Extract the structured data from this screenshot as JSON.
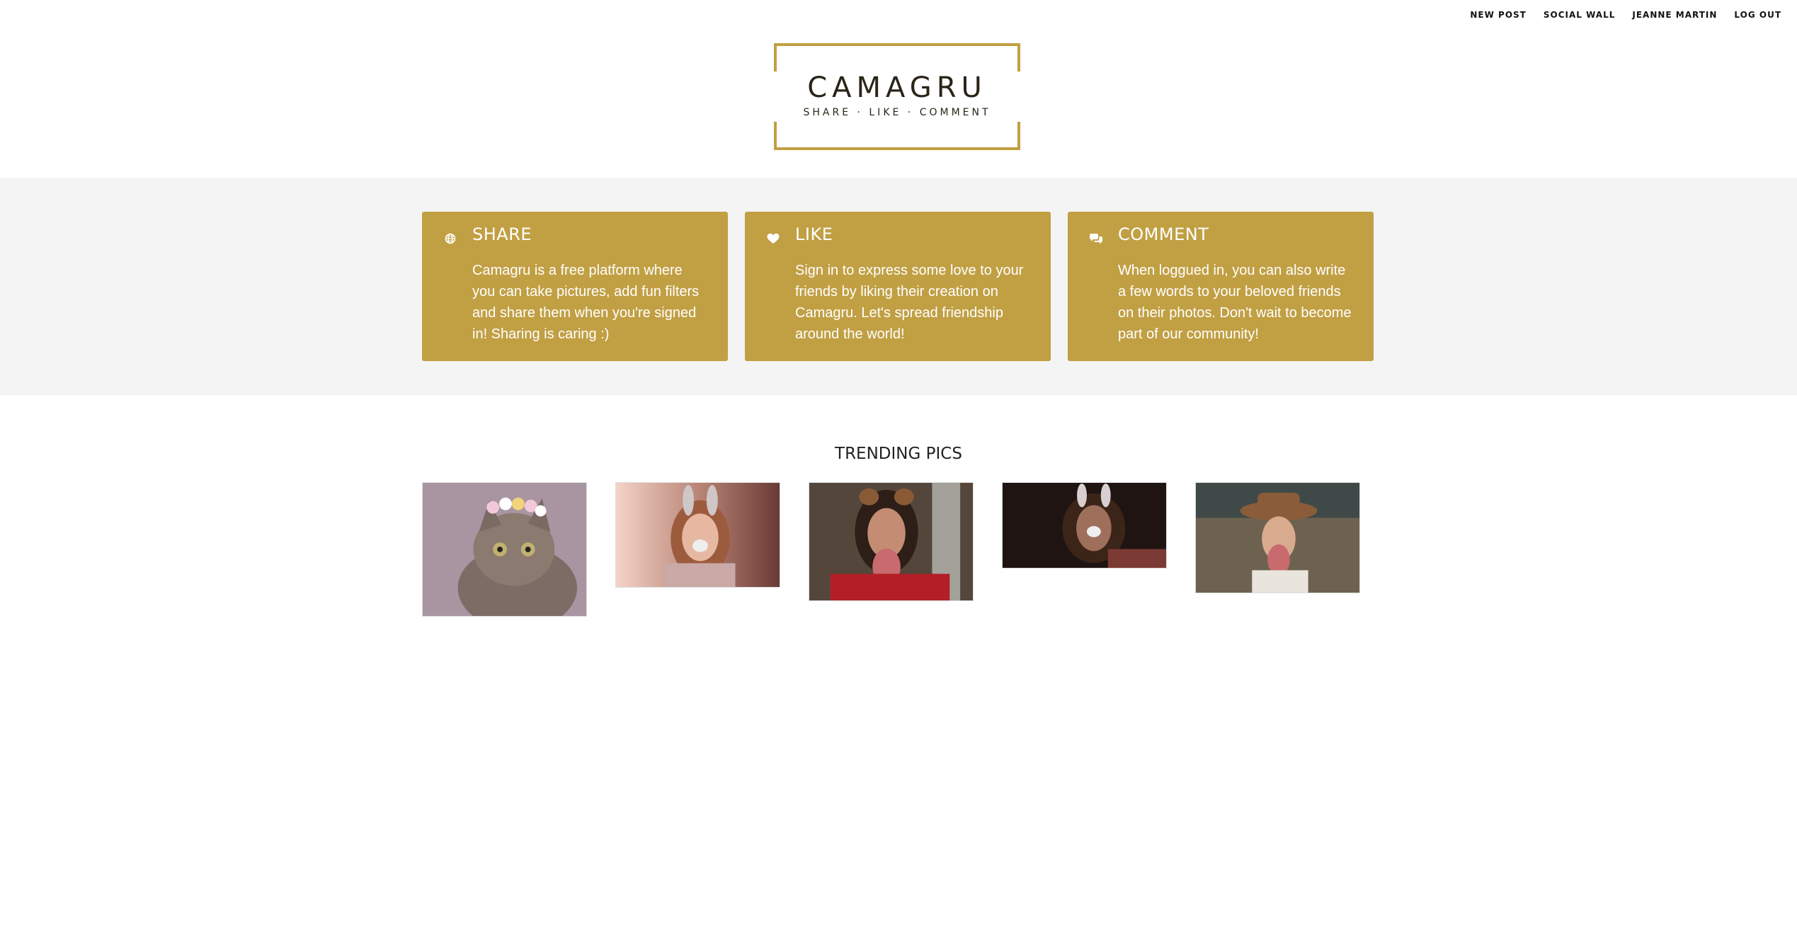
{
  "nav": {
    "new_post": "NEW POST",
    "social_wall": "SOCIAL WALL",
    "user": "JEANNE MARTIN",
    "logout": "LOG OUT"
  },
  "logo": {
    "title": "CAMAGRU",
    "subtitle": "SHARE · LIKE · COMMENT"
  },
  "features": [
    {
      "icon": "globe-icon",
      "title": "SHARE",
      "text": "Camagru is a free platform where you can take pictures, add fun filters and share them when you're signed in! Sharing is caring :)"
    },
    {
      "icon": "heart-icon",
      "title": "LIKE",
      "text": "Sign in to express some love to your friends by liking their creation on Camagru. Let's spread friendship around the world!"
    },
    {
      "icon": "comments-icon",
      "title": "COMMENT",
      "text": "When loggued in, you can also write a few words to your beloved friends on their photos. Don't wait to become part of our community!"
    }
  ],
  "trending": {
    "title": "TRENDING PICS"
  },
  "colors": {
    "accent": "#c19f43",
    "band": "#f4f4f4"
  }
}
